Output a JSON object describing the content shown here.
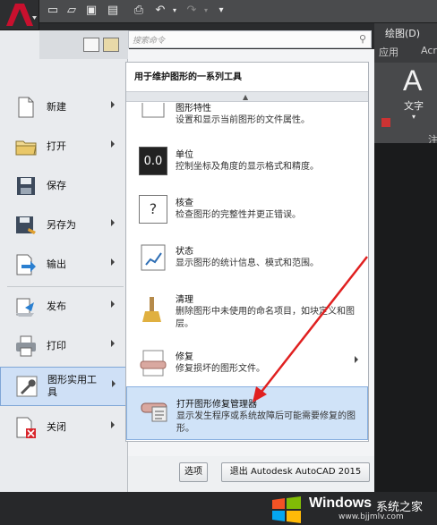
{
  "ribbon": {
    "tab1": "绘图(D)",
    "tab2": "应用",
    "tab3": "Acr",
    "text_label": "文字",
    "note_label": "注"
  },
  "left_menu": [
    {
      "label": "新建",
      "icon": "new-file-icon",
      "has_arrow": true
    },
    {
      "label": "打开",
      "icon": "open-folder-icon",
      "has_arrow": true
    },
    {
      "label": "保存",
      "icon": "save-disk-icon",
      "has_arrow": false
    },
    {
      "label": "另存为",
      "icon": "save-as-icon",
      "has_arrow": true
    },
    {
      "label": "输出",
      "icon": "export-icon",
      "has_arrow": true
    },
    {
      "label": "发布",
      "icon": "publish-icon",
      "has_arrow": true
    },
    {
      "label": "打印",
      "icon": "printer-icon",
      "has_arrow": true
    },
    {
      "label": "图形实用工具",
      "icon": "wrench-icon",
      "has_arrow": true,
      "selected": true
    },
    {
      "label": "关闭",
      "icon": "close-file-icon",
      "has_arrow": true
    }
  ],
  "search": {
    "placeholder": "搜索命令"
  },
  "submenu": {
    "title": "用于维护图形的一系列工具",
    "items": [
      {
        "title": "图形特性",
        "desc": "设置和显示当前图形的文件属性。",
        "icon": "drawing-properties-icon"
      },
      {
        "title": "单位",
        "desc": "控制坐标及角度的显示格式和精度。",
        "icon": "units-icon",
        "icon_text": "0.0"
      },
      {
        "title": "核查",
        "desc": "检查图形的完整性并更正错误。",
        "icon": "audit-icon",
        "icon_text": "?"
      },
      {
        "title": "状态",
        "desc": "显示图形的统计信息、模式和范围。",
        "icon": "status-icon"
      },
      {
        "title": "清理",
        "desc": "删除图形中未使用的命名项目，如块定义和图层。",
        "icon": "purge-brush-icon"
      },
      {
        "title": "修复",
        "desc": "修复损坏的图形文件。",
        "icon": "recover-icon",
        "has_arrow": true
      },
      {
        "title": "打开图形修复管理器",
        "desc": "显示发生程序或系统故障后可能需要修复的图形。",
        "icon": "recovery-manager-icon",
        "selected": true
      }
    ]
  },
  "buttons": {
    "options": "选项",
    "exit": "退出 Autodesk AutoCAD 2015"
  },
  "watermark": {
    "brand": "Windows",
    "brand_cn": "系统之家",
    "url": "www.bjjmlv.com"
  },
  "colors": {
    "accent_red": "#c8102e",
    "selection_blue": "#d0e3f8",
    "arrow_red": "#e02020"
  }
}
